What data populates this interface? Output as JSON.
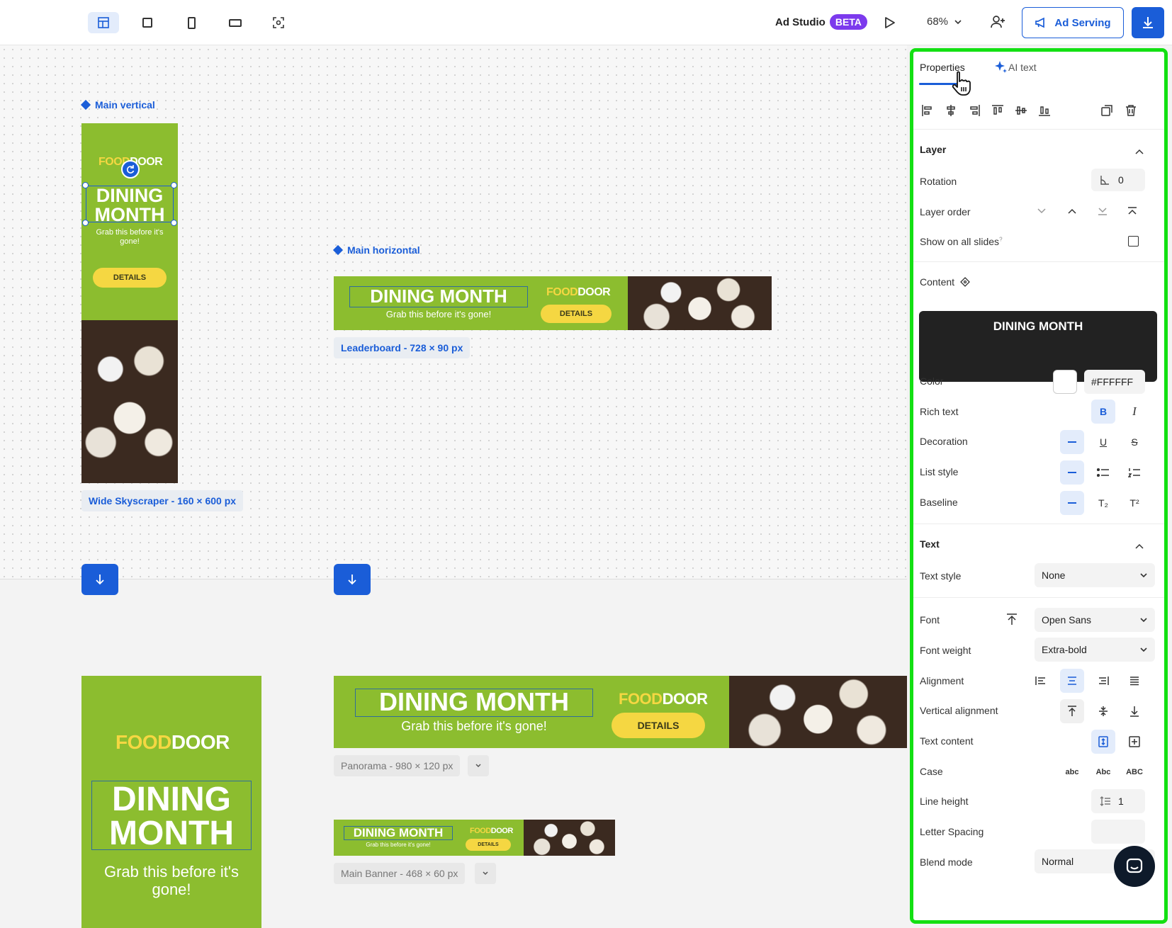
{
  "toolbar": {
    "icons": [
      "layout-icon",
      "square-icon",
      "portrait-icon",
      "landscape-icon",
      "focus-icon"
    ],
    "brand": "Ad Studio",
    "badge": "BETA",
    "zoom": "68%",
    "ad_serving": "Ad Serving"
  },
  "canvas": {
    "frame_vertical": "Main vertical",
    "frame_horizontal": "Main horizontal",
    "size_skyscraper": "Wide Skyscraper - 160 × 600 px",
    "size_leaderboard": "Leaderboard - 728 × 90 px",
    "size_panorama": "Panorama - 980 × 120 px",
    "size_mainbanner": "Main Banner - 468 × 60 px",
    "ad": {
      "logo_a": "FOOD",
      "logo_b": "DOOR",
      "title": "DINING MONTH",
      "title_l1": "DINING",
      "title_l2": "MONTH",
      "subtitle": "Grab this before it's gone!",
      "sub_l1": "Grab this before it's",
      "sub_l2": "gone!",
      "cta": "DETAILS"
    }
  },
  "panel": {
    "tab_properties": "Properties",
    "tab_ai": "AI text",
    "layer": {
      "heading": "Layer",
      "rotation_label": "Rotation",
      "rotation_value": "0",
      "layer_order_label": "Layer order",
      "show_all_label": "Show on all slides",
      "show_all_hint": "?"
    },
    "content": {
      "label": "Content",
      "value": "DINING MONTH",
      "color_label": "Color",
      "color_value": "#FFFFFF",
      "rich_label": "Rich text",
      "bold": "B",
      "italic": "I",
      "decoration_label": "Decoration",
      "underline": "U",
      "strike": "S",
      "list_label": "List style",
      "baseline_label": "Baseline",
      "sub": "T₂",
      "sup": "T²"
    },
    "text": {
      "heading": "Text",
      "style_label": "Text style",
      "style_value": "None",
      "font_label": "Font",
      "font_value": "Open Sans",
      "weight_label": "Font weight",
      "weight_value": "Extra-bold",
      "alignment_label": "Alignment",
      "valign_label": "Vertical alignment",
      "content_label": "Text content",
      "case_label": "Case",
      "case_lower": "abc",
      "case_title": "Abc",
      "case_upper": "ABC",
      "lineheight_label": "Line height",
      "lineheight_value": "1",
      "spacing_label": "Letter Spacing",
      "blend_label": "Blend mode",
      "blend_value": "Normal"
    }
  }
}
